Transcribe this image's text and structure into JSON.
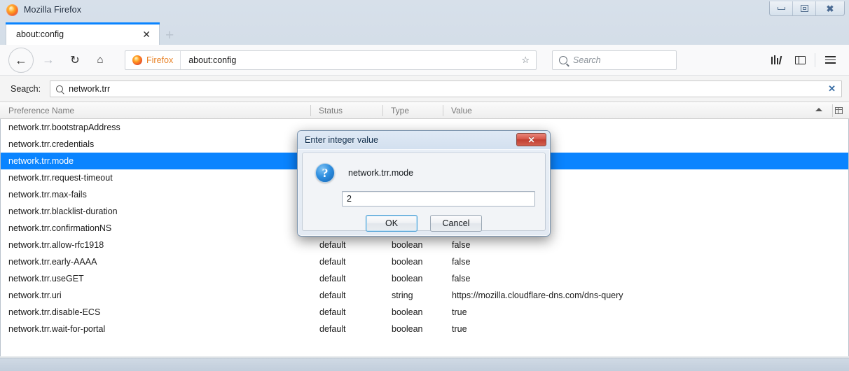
{
  "window": {
    "title": "Mozilla Firefox",
    "icon": "firefox-logo",
    "controls": {
      "minimize": "minimize",
      "restore": "restore",
      "close": "close"
    }
  },
  "tabs": {
    "active": {
      "label": "about:config",
      "close_label": "✕"
    },
    "new_tab_label": "+"
  },
  "nav": {
    "back": "←",
    "forward": "→",
    "reload": "↻",
    "home": "⌂",
    "urlbar": {
      "chip_label": "Firefox",
      "value": "about:config",
      "bookmark_icon": "☆"
    },
    "search": {
      "placeholder": "Search"
    },
    "library": "library",
    "sidebar": "sidebar",
    "menu": "menu"
  },
  "config_search": {
    "label_prefix": "Sea",
    "label_accesskey": "r",
    "label_suffix": "ch:",
    "value": "network.trr",
    "clear_label": "✕"
  },
  "table": {
    "columns": [
      "Preference Name",
      "Status",
      "Type",
      "Value"
    ],
    "sort": "ascending",
    "rows": [
      {
        "name": "network.trr.bootstrapAddress",
        "status": "",
        "type": "",
        "value": "",
        "selected": false
      },
      {
        "name": "network.trr.credentials",
        "status": "",
        "type": "",
        "value": "",
        "selected": false
      },
      {
        "name": "network.trr.mode",
        "status": "",
        "type": "",
        "value": "",
        "selected": true
      },
      {
        "name": "network.trr.request-timeout",
        "status": "",
        "type": "",
        "value": "",
        "selected": false
      },
      {
        "name": "network.trr.max-fails",
        "status": "",
        "type": "",
        "value": "",
        "selected": false
      },
      {
        "name": "network.trr.blacklist-duration",
        "status": "",
        "type": "",
        "value": "",
        "selected": false
      },
      {
        "name": "network.trr.confirmationNS",
        "status": "",
        "type": "",
        "value": "",
        "selected": false
      },
      {
        "name": "network.trr.allow-rfc1918",
        "status": "default",
        "type": "boolean",
        "value": "false",
        "selected": false
      },
      {
        "name": "network.trr.early-AAAA",
        "status": "default",
        "type": "boolean",
        "value": "false",
        "selected": false
      },
      {
        "name": "network.trr.useGET",
        "status": "default",
        "type": "boolean",
        "value": "false",
        "selected": false
      },
      {
        "name": "network.trr.uri",
        "status": "default",
        "type": "string",
        "value": "https://mozilla.cloudflare-dns.com/dns-query",
        "selected": false
      },
      {
        "name": "network.trr.disable-ECS",
        "status": "default",
        "type": "boolean",
        "value": "true",
        "selected": false
      },
      {
        "name": "network.trr.wait-for-portal",
        "status": "default",
        "type": "boolean",
        "value": "true",
        "selected": false
      }
    ]
  },
  "dialog": {
    "title": "Enter integer value",
    "close_label": "✕",
    "icon": "question-mark",
    "prompt": "network.trr.mode",
    "input_value": "2",
    "ok_label": "OK",
    "cancel_label": "Cancel"
  },
  "colors": {
    "selection": "#0a84ff",
    "tab_accent": "#0a84ff",
    "firefox_orange": "#e8842a",
    "dialog_close": "#c03e31"
  }
}
